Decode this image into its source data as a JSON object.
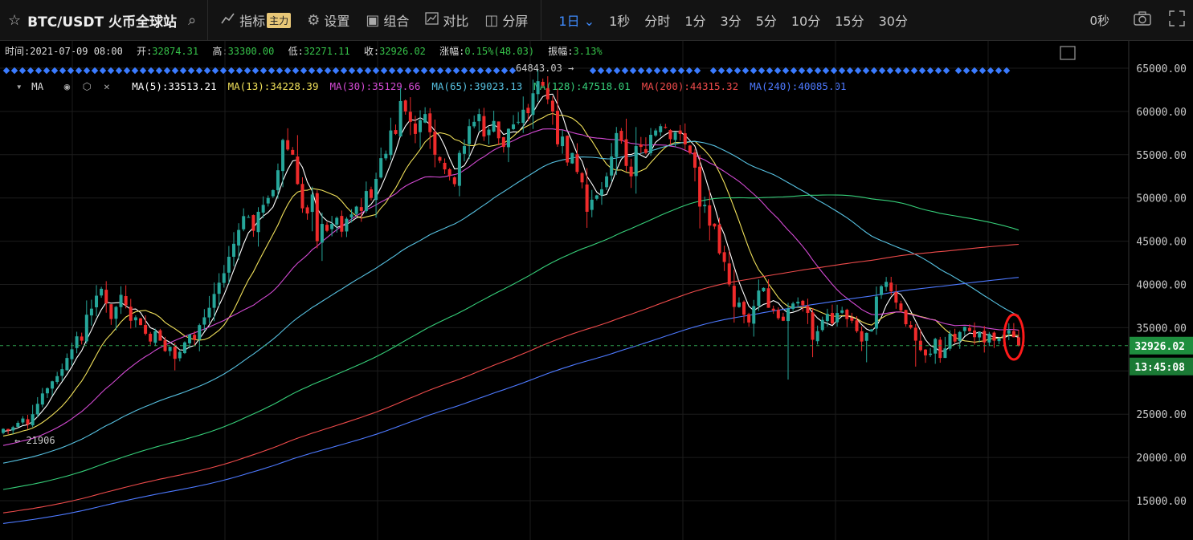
{
  "toolbar": {
    "symbol": "BTC/USDT 火币全球站",
    "indicator_label": "指标",
    "indicator_tag": "主力",
    "settings_label": "设置",
    "combo_label": "组合",
    "compare_label": "对比",
    "split_label": "分屏",
    "intervals": [
      "1日",
      "1秒",
      "分时",
      "1分",
      "3分",
      "5分",
      "10分",
      "15分",
      "30分"
    ],
    "active_interval": "1日",
    "countdown": "0秒"
  },
  "ohlc": {
    "time_label": "时间:",
    "time": "2021-07-09 08:00",
    "open_label": "开:",
    "open": "32874.31",
    "high_label": "高:",
    "high": "33300.00",
    "low_label": "低:",
    "low": "32271.11",
    "close_label": "收:",
    "close": "32926.02",
    "change_label": "涨幅:",
    "change": "0.15%(48.03)",
    "amp_label": "振幅:",
    "amp": "3.13%"
  },
  "ma_legend": {
    "title": "MA",
    "items": [
      {
        "label": "MA(5):33513.21",
        "color": "#ffffff"
      },
      {
        "label": "MA(13):34228.39",
        "color": "#f0e05a"
      },
      {
        "label": "MA(30):35129.66",
        "color": "#d34ad3"
      },
      {
        "label": "MA(65):39023.13",
        "color": "#56c0e0"
      },
      {
        "label": "MA(128):47518.01",
        "color": "#36d07a"
      },
      {
        "label": "MA(200):44315.32",
        "color": "#ef4b4b"
      },
      {
        "label": "MA(240):40085.01",
        "color": "#4d79ff"
      }
    ]
  },
  "colors": {
    "up": "#26a69a",
    "down": "#ef2b2b",
    "price_tag": "#1e8e3e",
    "grid": "#1c1c1c"
  },
  "chart_data": {
    "type": "candlestick",
    "y_ticks": [
      "65000.00",
      "60000.00",
      "55000.00",
      "50000.00",
      "45000.00",
      "40000.00",
      "35000.00",
      "30000.00",
      "25000.00",
      "20000.00",
      "15000.00"
    ],
    "ylim": [
      13000,
      66000
    ],
    "current_price": "32926.02",
    "countdown_time": "13:45:08",
    "annotations": {
      "high": "64843.03",
      "low": "21906"
    },
    "closes": [
      23300,
      23100,
      23500,
      24000,
      24500,
      23800,
      25000,
      26200,
      27400,
      28000,
      28800,
      29400,
      30200,
      31500,
      32500,
      34000,
      33500,
      36500,
      37200,
      38700,
      39500,
      37800,
      36000,
      37400,
      38800,
      37600,
      35800,
      36200,
      35300,
      34300,
      33400,
      34600,
      33500,
      32300,
      32800,
      31400,
      32200,
      33300,
      34200,
      33600,
      35300,
      36200,
      37300,
      38900,
      40200,
      41300,
      43200,
      44700,
      46300,
      47900,
      47800,
      46200,
      48400,
      49200,
      50000,
      50900,
      53200,
      56700,
      55600,
      55000,
      51600,
      48800,
      48200,
      50400,
      45000,
      47000,
      46200,
      47000,
      47700,
      46100,
      47600,
      48100,
      49000,
      48500,
      50800,
      50000,
      52200,
      54600,
      55100,
      57800,
      57400,
      61200,
      60000,
      58800,
      57400,
      59000,
      59700,
      57600,
      55000,
      54300,
      53300,
      52600,
      51600,
      55200,
      56000,
      58300,
      58800,
      59700,
      57100,
      57900,
      58900,
      56900,
      55900,
      58000,
      58500,
      58800,
      60200,
      59800,
      62100,
      63500,
      63000,
      61400,
      60000,
      56200,
      57100,
      54100,
      55200,
      53000,
      51800,
      48400,
      49800,
      50300,
      51000,
      52500,
      54800,
      57500,
      56600,
      53700,
      52500,
      56000,
      55900,
      55200,
      57300,
      57800,
      58300,
      58100,
      56800,
      57600,
      57400,
      56200,
      55200,
      53500,
      49000,
      49200,
      46800,
      46700,
      43600,
      42600,
      40000,
      37400,
      37900,
      36500,
      35600,
      37500,
      39300,
      39600,
      37300,
      37000,
      36100,
      35800,
      37200,
      37800,
      38000,
      37600,
      36700,
      33600,
      34600,
      35900,
      36600,
      35500,
      36700,
      37000,
      36000,
      35800,
      34600,
      33400,
      34400,
      34800,
      38600,
      39800,
      40300,
      39200,
      37900,
      37000,
      35400,
      35000,
      33500,
      32400,
      31800,
      32000,
      33700,
      31500,
      32600,
      34300,
      33400,
      34500,
      35100,
      34600,
      33900,
      34500,
      33300,
      34300,
      33500,
      33800,
      34200,
      34700,
      33900,
      32926
    ],
    "moving_averages": {
      "MA(5)": "33513.21",
      "MA(13)": "34228.39",
      "MA(30)": "35129.66",
      "MA(65)": "39023.13",
      "MA(128)": "47518.01",
      "MA(200)": "44315.32",
      "MA(240)": "40085.01"
    }
  }
}
